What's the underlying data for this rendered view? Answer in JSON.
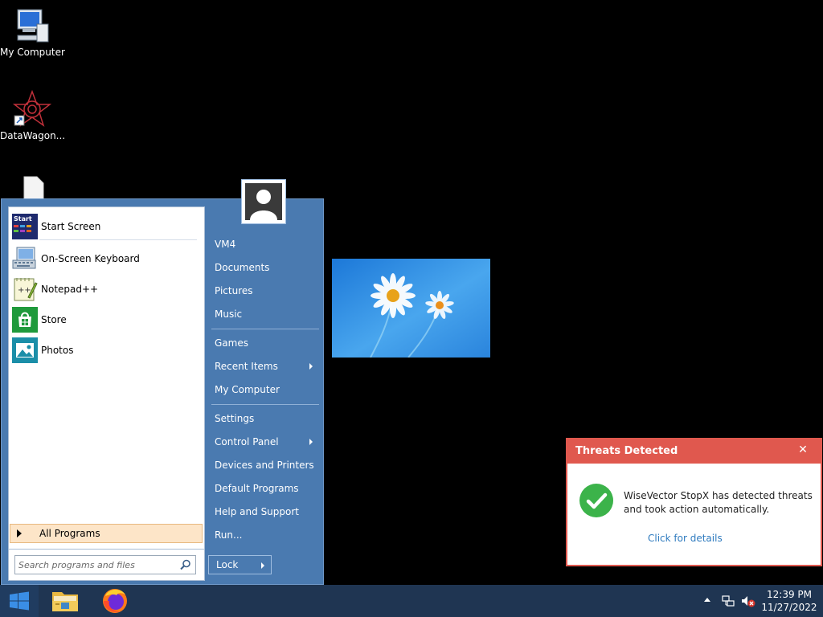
{
  "desktop": {
    "icons": [
      {
        "label": "My Computer",
        "icon": "computer-icon"
      },
      {
        "label": "DataWagon...",
        "icon": "datawagon-icon"
      },
      {
        "label": "",
        "icon": "file-icon"
      }
    ]
  },
  "start_menu": {
    "pinned": [
      {
        "label": "Start Screen",
        "icon": "start-screen-icon",
        "icon_text": "Start"
      },
      {
        "label": "On-Screen Keyboard",
        "icon": "keyboard-icon"
      },
      {
        "label": "Notepad++",
        "icon": "notepad-plus-icon"
      },
      {
        "label": "Store",
        "icon": "store-icon"
      },
      {
        "label": "Photos",
        "icon": "photos-icon"
      }
    ],
    "all_programs": "All Programs",
    "search": {
      "placeholder": "Search programs and files",
      "value": ""
    },
    "right_items": [
      {
        "label": "VM4"
      },
      {
        "label": "Documents"
      },
      {
        "label": "Pictures"
      },
      {
        "label": "Music"
      },
      {
        "label": "Games"
      },
      {
        "label": "Recent Items",
        "submenu": true
      },
      {
        "label": "My Computer"
      },
      {
        "label": "Settings"
      },
      {
        "label": "Control Panel",
        "submenu": true
      },
      {
        "label": "Devices and Printers"
      },
      {
        "label": "Default Programs"
      },
      {
        "label": "Help and Support"
      },
      {
        "label": "Run..."
      }
    ],
    "lock_label": "Lock"
  },
  "toast": {
    "title": "Threats Detected",
    "message": "WiseVector StopX has detected threats and took action automatically.",
    "link": "Click for details",
    "close": "✕",
    "accent": "#e0584e"
  },
  "taskbar": {
    "time": "12:39 PM",
    "date": "11/27/2022"
  },
  "colors": {
    "start_menu_bg": "#4a7ab0",
    "taskbar_bg": "#1f3552",
    "ok_green": "#3cb34a"
  }
}
